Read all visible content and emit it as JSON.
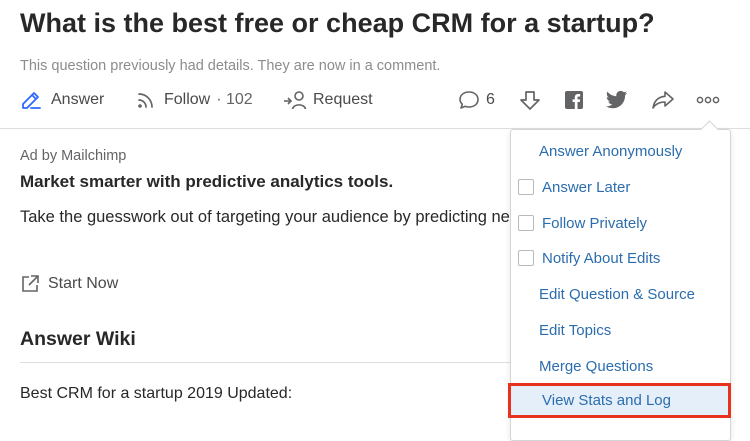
{
  "question": {
    "title": "What is the best free or cheap CRM for a startup?",
    "details_note": "This question previously had details. They are now in a comment."
  },
  "actions": {
    "answer_label": "Answer",
    "follow_label": "Follow",
    "follow_count": "· 102",
    "request_label": "Request",
    "comment_count": "6"
  },
  "ad": {
    "by_line": "Ad by Mailchimp",
    "headline": "Market smarter with predictive analytics tools.",
    "body": "Take the guesswork out of targeting your audience by predicting next.",
    "cta": "Start Now"
  },
  "wiki": {
    "heading": "Answer Wiki",
    "text": "Best CRM for a startup 2019 Updated:"
  },
  "menu": {
    "items": [
      {
        "label": "Answer Anonymously",
        "checkbox": false
      },
      {
        "label": "Answer Later",
        "checkbox": true
      },
      {
        "label": "Follow Privately",
        "checkbox": true
      },
      {
        "label": "Notify About Edits",
        "checkbox": true
      },
      {
        "label": "Edit Question & Source",
        "checkbox": false
      },
      {
        "label": "Edit Topics",
        "checkbox": false
      },
      {
        "label": "Merge Questions",
        "checkbox": false
      },
      {
        "label": "View Stats and Log",
        "checkbox": false,
        "highlighted": true
      }
    ]
  },
  "icons": {
    "answer": "pencil-icon",
    "follow": "rss-feed-icon",
    "request": "request-user-icon",
    "comments": "comment-bubble-icon",
    "downvote": "downvote-arrow-icon",
    "facebook": "facebook-icon",
    "twitter": "twitter-icon",
    "share": "share-arrow-icon",
    "more": "more-dots-icon",
    "external": "external-link-icon"
  },
  "colors": {
    "accent_blue": "#2e69ff",
    "menu_link": "#2b6dad",
    "highlight_border": "#e7321e",
    "highlight_fill": "#e5eff9"
  }
}
